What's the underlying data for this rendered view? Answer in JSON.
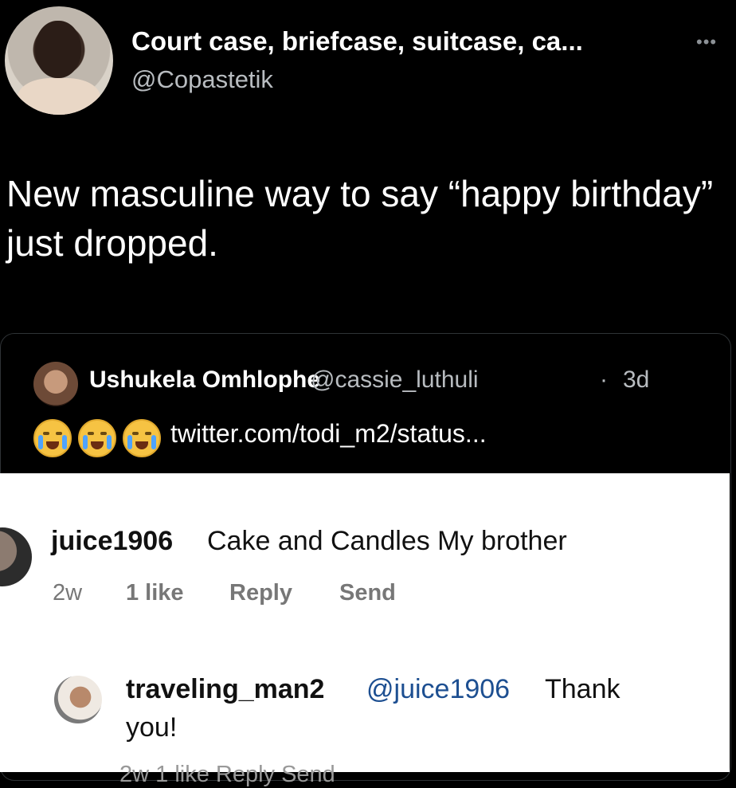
{
  "tweet": {
    "display_name": "Court case, briefcase, suitcase, ca...",
    "handle": "@Copastetik",
    "more_icon": "more-horizontal-icon",
    "text": "New masculine way to say “happy birthday” just dropped."
  },
  "quoted_tweet": {
    "name": "Ushukela Omhlophe",
    "handle": "@cassie_luthuli",
    "separator": "·",
    "time": "3d",
    "emojis": [
      "crying-face-icon",
      "crying-face-icon",
      "crying-face-icon"
    ],
    "link": "twitter.com/todi_m2/status..."
  },
  "instagram_comments": [
    {
      "user": "juice1906",
      "text": "Cake and Candles My brother",
      "age": "2w",
      "likes": "1 like",
      "reply": "Reply",
      "send": "Send"
    },
    {
      "user": "traveling_man2",
      "mention": "@juice1906",
      "text_line1": "Thank",
      "text_line2": "you!",
      "meta_cutoff": "2w    1 like    Reply    Send"
    }
  ],
  "colors": {
    "background": "#000000",
    "secondary_text": "#b8bcc0",
    "mention_blue": "#1d4f91"
  }
}
